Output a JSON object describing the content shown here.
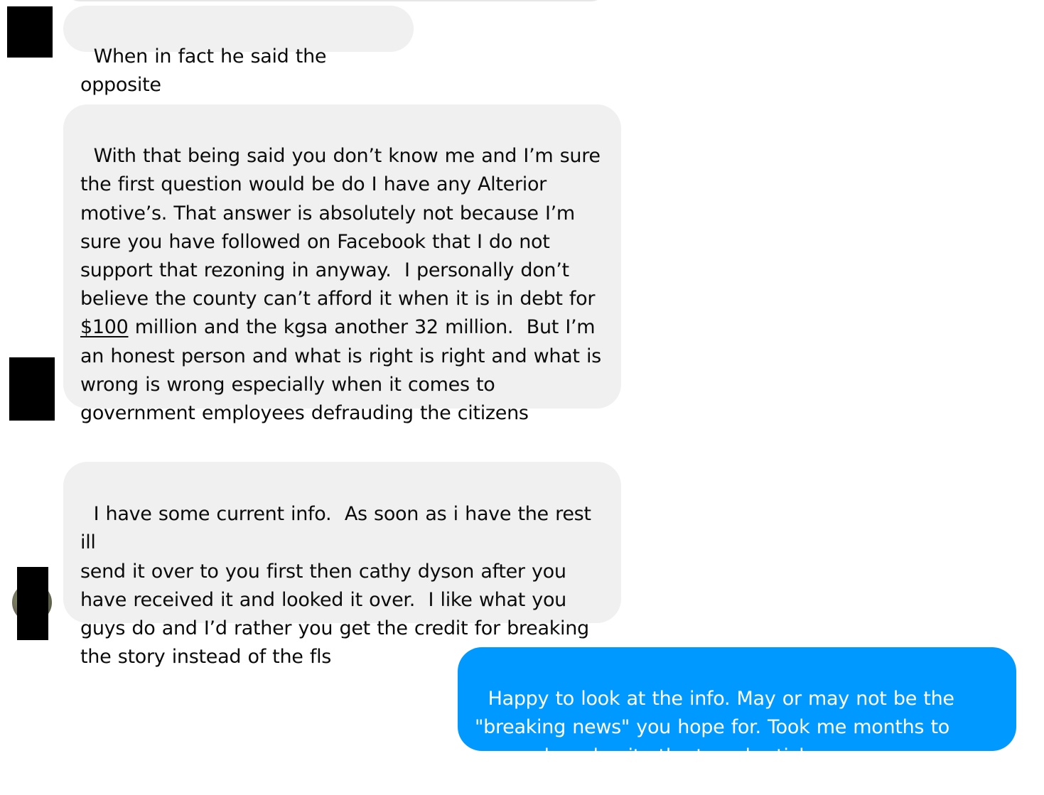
{
  "conversation": {
    "messages": [
      {
        "sender": "them",
        "text": "When in fact he said the opposite"
      },
      {
        "sender": "them",
        "text_before_link": "With that being said you don’t know me and I’m sure\nthe first question would be do I have any Alterior\nmotive’s. That answer is absolutely not because I’m\nsure you have followed on Facebook that I do not\nsupport that rezoning in anyway.  I personally don’t\nbelieve the county can’t afford it when it is in debt for\n",
        "link_text": "$100",
        "text_after_link": " million and the kgsa another 32 million.  But I’m\nan honest person and what is right is right and what is\nwrong is wrong especially when it comes to\ngovernment employees defrauding the citizens"
      },
      {
        "sender": "them",
        "text": "I have some current info.  As soon as i have the rest ill\nsend it over to you first then cathy dyson after you\nhave received it and looked it over.  I like what you\nguys do and I’d rather you get the credit for breaking\nthe story instead of the fls"
      },
      {
        "sender": "me",
        "text": "Happy to look at the info. May or may not be the\n\"breaking news\" you hope for. Took me months to\nresearch and write the travel articles."
      }
    ]
  },
  "colors": {
    "incoming_bubble": "#f0f0f0",
    "outgoing_bubble": "#0099ff",
    "redaction": "#000000"
  }
}
